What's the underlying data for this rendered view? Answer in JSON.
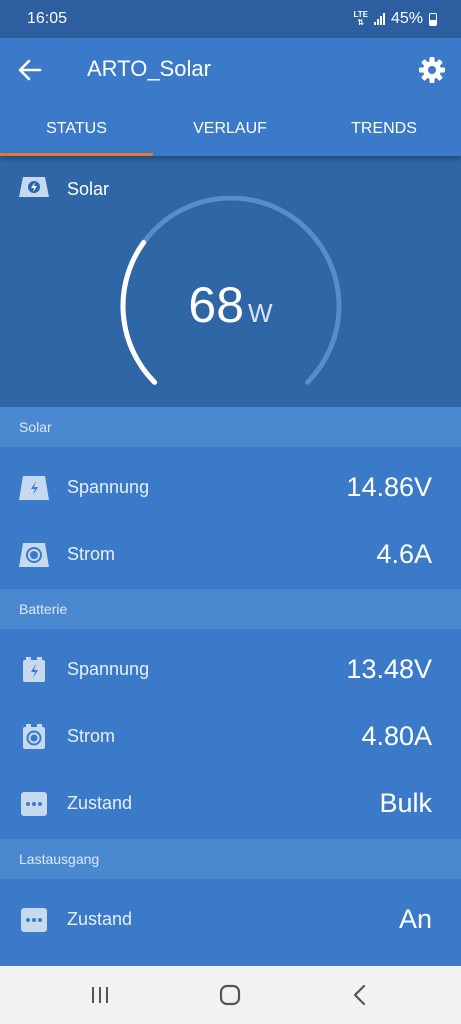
{
  "status_bar": {
    "time": "16:05",
    "network": "LTE",
    "battery": "45%"
  },
  "app_bar": {
    "title": "ARTO_Solar",
    "back_icon": "arrow-left-icon",
    "settings_icon": "gear-icon"
  },
  "tabs": [
    {
      "label": "STATUS",
      "active": true
    },
    {
      "label": "VERLAUF",
      "active": false
    },
    {
      "label": "TRENDS",
      "active": false
    }
  ],
  "hero": {
    "label": "Solar",
    "icon": "solar-panel-icon",
    "value": "68",
    "unit": "W",
    "gauge_fraction": 0.3
  },
  "sections": [
    {
      "title": "Solar",
      "rows": [
        {
          "icon": "solar-voltage-icon",
          "label": "Spannung",
          "value": "14.86V"
        },
        {
          "icon": "solar-current-icon",
          "label": "Strom",
          "value": "4.6A"
        }
      ]
    },
    {
      "title": "Batterie",
      "rows": [
        {
          "icon": "battery-voltage-icon",
          "label": "Spannung",
          "value": "13.48V"
        },
        {
          "icon": "battery-current-icon",
          "label": "Strom",
          "value": "4.80A"
        },
        {
          "icon": "state-dots-icon",
          "label": "Zustand",
          "value": "Bulk"
        }
      ]
    },
    {
      "title": "Lastausgang",
      "rows": [
        {
          "icon": "state-dots-icon",
          "label": "Zustand",
          "value": "An"
        }
      ]
    }
  ],
  "colors": {
    "accent": "#e8743b",
    "primary": "#3a7ac8",
    "hero_bg": "#2e66a6",
    "section_bg": "#4a88d0"
  },
  "nav_bar": {
    "recents_icon": "recents-icon",
    "home_icon": "home-icon",
    "back_icon": "back-chevron-icon"
  }
}
